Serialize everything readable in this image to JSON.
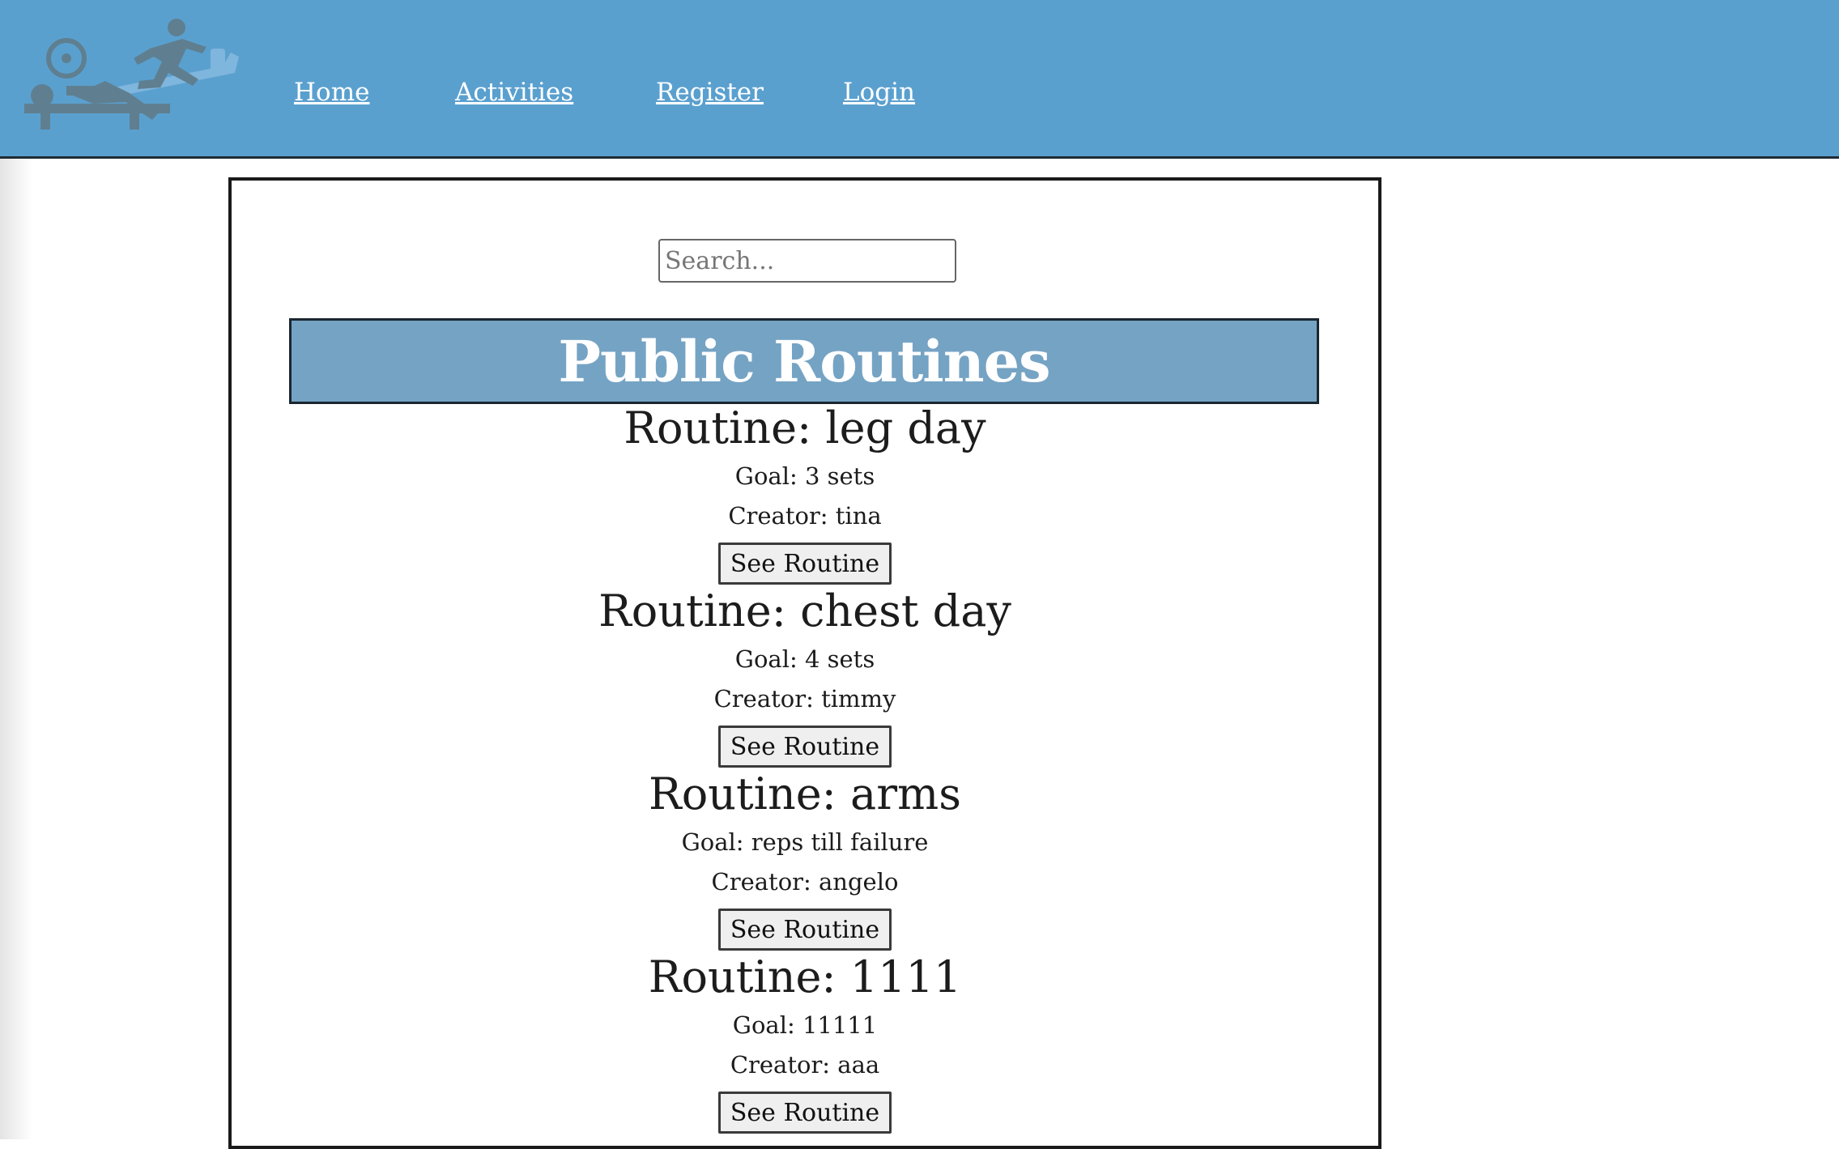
{
  "header": {
    "logo_icon": "workout-logo-icon",
    "nav": [
      {
        "label": "Home"
      },
      {
        "label": "Activities"
      },
      {
        "label": "Register"
      },
      {
        "label": "Login"
      }
    ]
  },
  "search": {
    "placeholder": "Search...",
    "value": ""
  },
  "section_title": "Public Routines",
  "routines": [
    {
      "name": "Routine: leg day",
      "goal": "Goal: 3 sets",
      "creator": "Creator: tina",
      "button": "See Routine"
    },
    {
      "name": "Routine: chest day",
      "goal": "Goal: 4 sets",
      "creator": "Creator: timmy",
      "button": "See Routine"
    },
    {
      "name": "Routine: arms",
      "goal": "Goal: reps till failure",
      "creator": "Creator: angelo",
      "button": "See Routine"
    },
    {
      "name": "Routine: 1111",
      "goal": "Goal: 11111",
      "creator": "Creator: aaa",
      "button": "See Routine"
    }
  ],
  "colors": {
    "header_bg": "#5aa0cf",
    "banner_bg": "#75a3c4",
    "logo_gray": "#5f7f90"
  }
}
